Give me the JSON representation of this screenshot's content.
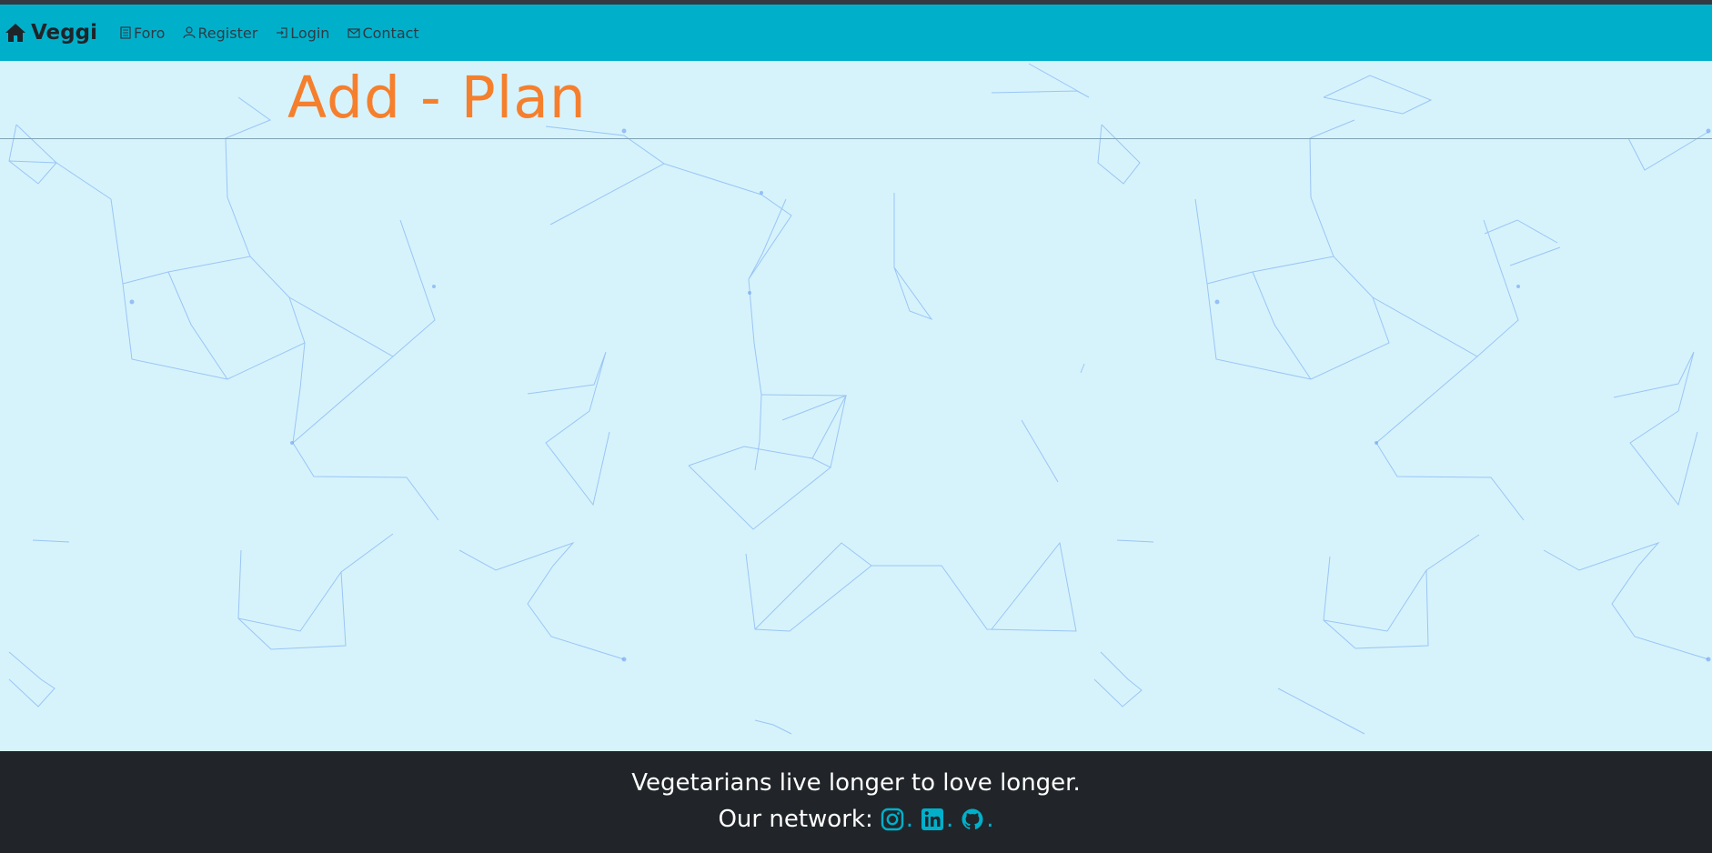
{
  "navbar": {
    "brand": "Veggi",
    "items": [
      {
        "label": "Foro",
        "icon": "journal-icon"
      },
      {
        "label": "Register",
        "icon": "person-icon"
      },
      {
        "label": "Login",
        "icon": "login-icon"
      },
      {
        "label": "Contact",
        "icon": "envelope-icon"
      }
    ]
  },
  "main": {
    "title": "Add - Plan"
  },
  "footer": {
    "tagline": "Vegetarians live longer to love longer.",
    "network_label": "Our network:",
    "socials": [
      "instagram-icon",
      "linkedin-icon",
      "github-icon"
    ],
    "separator": "."
  },
  "colors": {
    "navbar": "#00b0cb",
    "background": "#d6f3fc",
    "title": "#f57f2d",
    "footer": "#212529",
    "network_lines": "#6a9ff0"
  }
}
